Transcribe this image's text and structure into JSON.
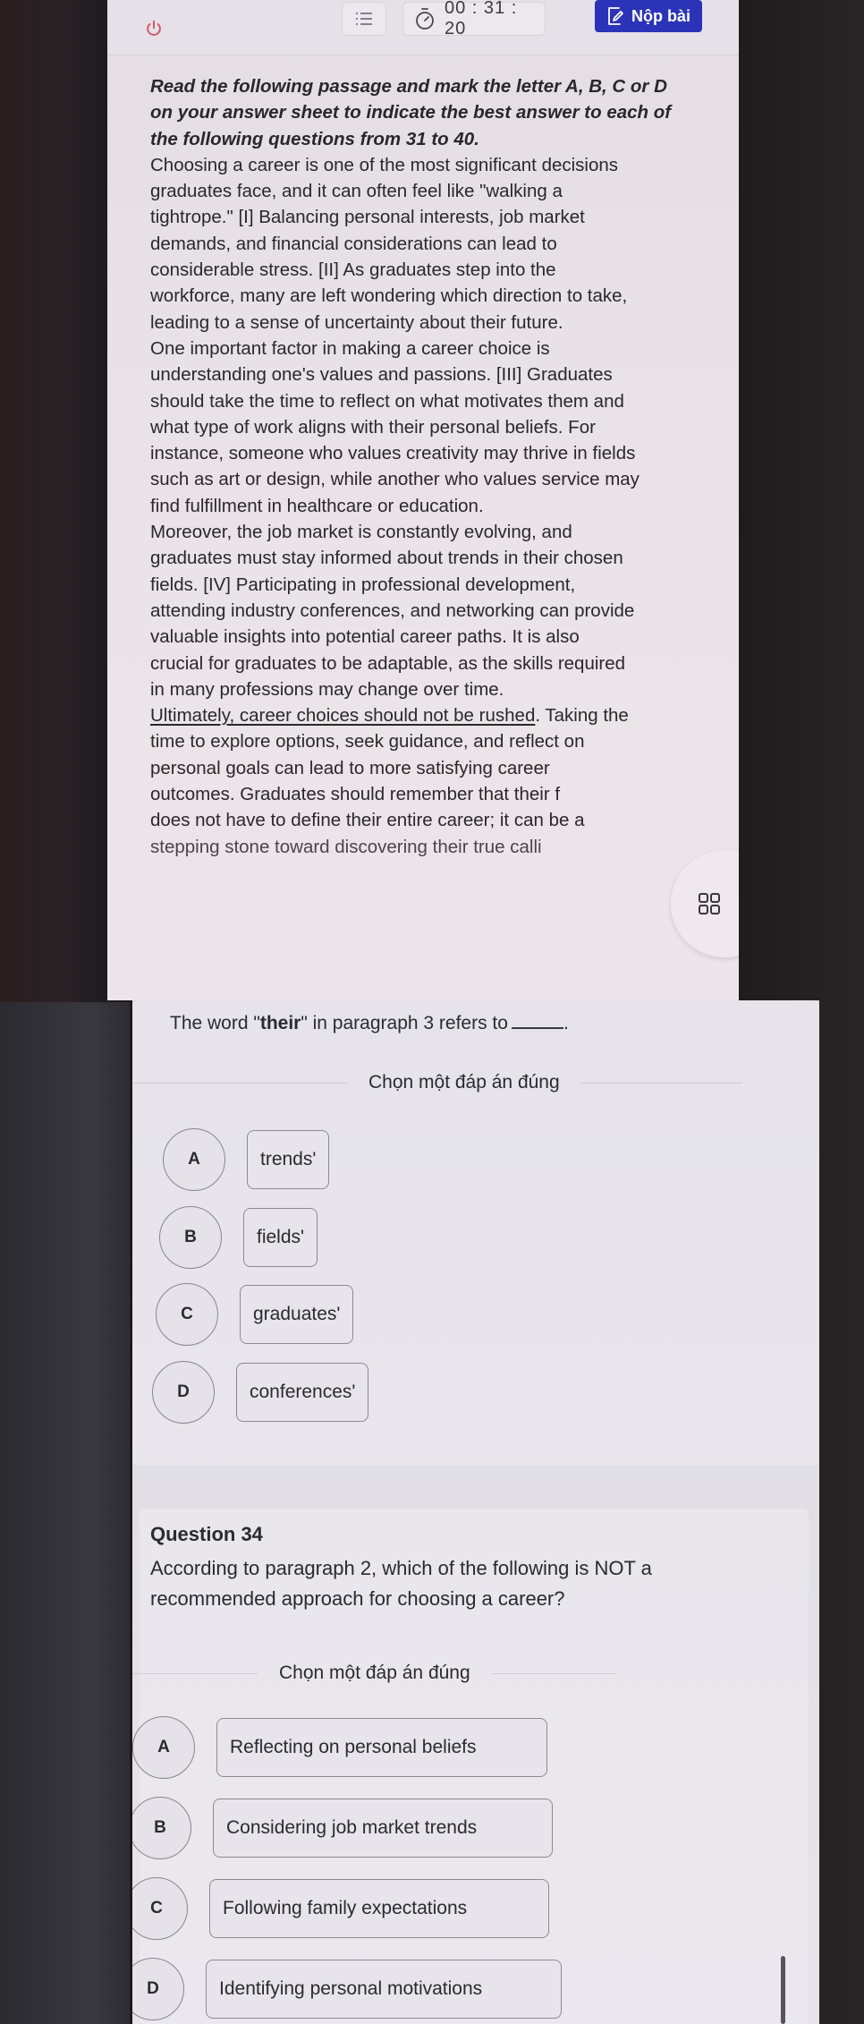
{
  "topbar": {
    "power_icon": "power-icon",
    "menu_icon": "list-icon",
    "timer_icon": "stopwatch-icon",
    "timer": "00 : 31 : 20",
    "submit_icon": "edit-document-icon",
    "submit_label": "Nộp bài",
    "accent_color": "#2b33b8"
  },
  "passage": {
    "instruction_lines": [
      "Read the following passage and mark the letter A, B, C or D",
      "on your answer sheet to indicate the best answer to each of",
      "the following questions from 31 to 40."
    ],
    "lines": [
      "Choosing a career is one of the most significant decisions",
      "graduates face, and it can often feel like \"walking a",
      "tightrope.\" [I] Balancing personal interests, job market",
      "demands, and financial considerations can lead to",
      "considerable stress. [II] As graduates step into the",
      "workforce, many are left wondering which direction to take,",
      "leading to a sense of uncertainty about their future.",
      "One important factor in making a career choice is",
      "understanding one's values and passions. [III] Graduates",
      "should take the time to reflect on what motivates them and",
      "what type of work aligns with their personal beliefs. For",
      "instance, someone who values creativity may thrive in fields",
      "such as art or design, while another who values service may",
      "find fulfillment in healthcare or education.",
      "Moreover, the job market is constantly evolving, and",
      "graduates must stay informed about trends in their chosen",
      "fields. [IV] Participating in professional development,",
      "attending industry conferences, and networking can provide",
      "valuable insights into potential career paths. It is also",
      "crucial for graduates to be adaptable, as the skills required",
      "in many professions may change over time."
    ],
    "underlined_sentence": "Ultimately, career choices should not be rushed",
    "after_underline": ". Taking the",
    "tail_lines": [
      "time to explore options, seek guidance, and reflect on",
      "personal goals can lead to more satisfying career",
      "outcomes. Graduates should remember that their f",
      "does not have to define their entire career; it can be a",
      "stepping stone toward discovering their true calli"
    ],
    "float_icon": "grid-icon"
  },
  "question33": {
    "stem_before": "The word \"",
    "stem_bold": "their",
    "stem_after": "\" in paragraph 3 refers to",
    "stem_end": ".",
    "choose_label": "Chọn một đáp án đúng",
    "options": [
      {
        "letter": "A",
        "text": "trends'"
      },
      {
        "letter": "B",
        "text": "fields'"
      },
      {
        "letter": "C",
        "text": "graduates'"
      },
      {
        "letter": "D",
        "text": "conferences'"
      }
    ]
  },
  "question34": {
    "title": "Question 34",
    "text_lines": [
      "According to paragraph 2, which of the following is NOT a",
      "recommended approach for choosing a career?"
    ],
    "choose_label": "Chọn một đáp án đúng",
    "options": [
      {
        "letter": "A",
        "text": "Reflecting on personal beliefs"
      },
      {
        "letter": "B",
        "text": "Considering job market trends"
      },
      {
        "letter": "C",
        "text": "Following family expectations"
      },
      {
        "letter": "D",
        "text": "Identifying personal motivations"
      }
    ]
  }
}
